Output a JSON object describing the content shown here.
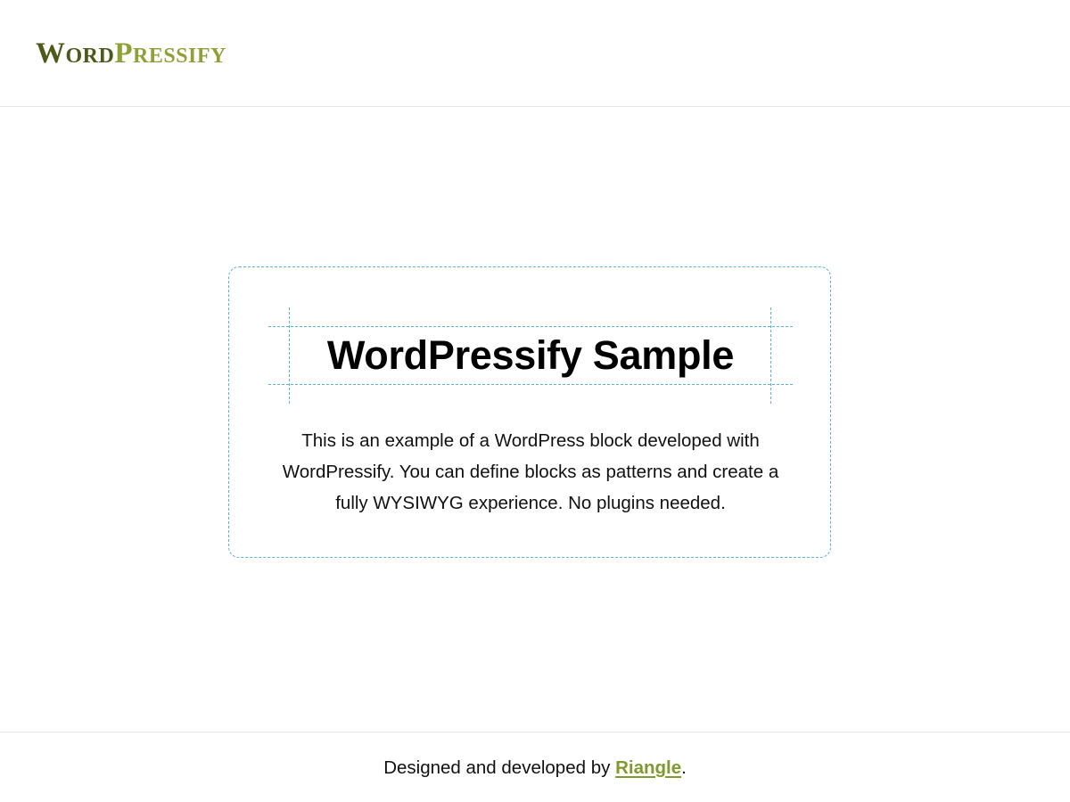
{
  "header": {
    "logo": {
      "part_one_initial": "W",
      "part_one_rest": "ord",
      "part_two_initial": "P",
      "part_two_rest": "ressify"
    }
  },
  "sample": {
    "title": "WordPressify Sample",
    "body": "This is an example of a WordPress block developed with WordPressify. You can define blocks as patterns and create a fully WYSIWYG experience. No plugins needed."
  },
  "footer": {
    "text_before": "Designed and developed by ",
    "link_label": "Riangle",
    "text_after": "."
  },
  "colors": {
    "logo_dark": "#4d5a19",
    "logo_light": "#8ea037",
    "guide_lines": "#5ab3d3",
    "footer_link": "#7f9a2e"
  }
}
